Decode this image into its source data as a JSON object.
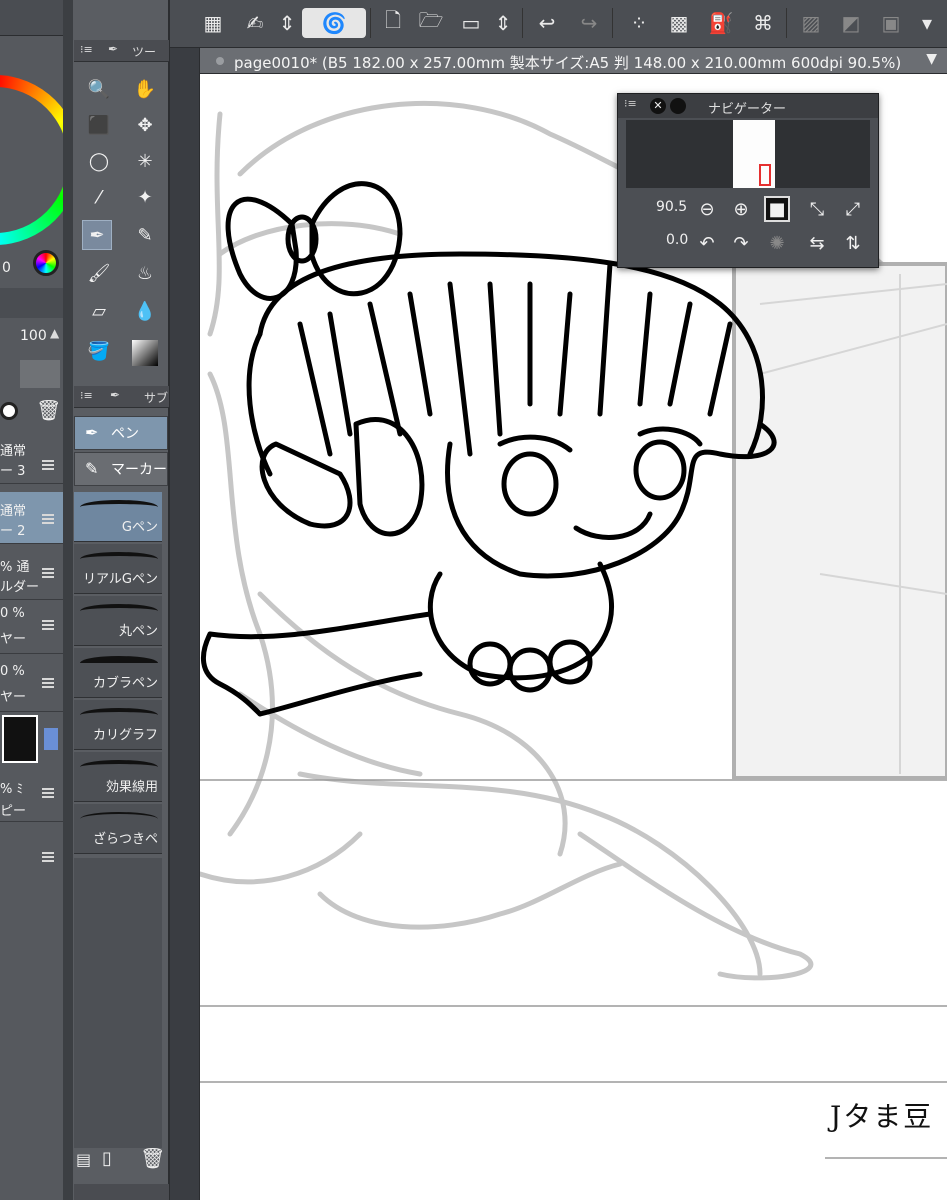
{
  "document": {
    "tab_title": "page0010* (B5 182.00 x 257.00mm 製本サイズ:A5 判 148.00 x 210.00mm 600dpi 90.5%)"
  },
  "left_panel": {
    "hue_value": "0",
    "opacity_value": "100",
    "layers": [
      {
        "line1": "通常",
        "line2": "ー 3"
      },
      {
        "line1": "通常",
        "line2": "ー 2"
      },
      {
        "line1": "% 通",
        "line2": "ルダー"
      },
      {
        "line1": "0 %",
        "line2": "ヤー"
      },
      {
        "line1": "0 %",
        "line2": "ヤー"
      },
      {
        "line1": "% ﾐ",
        "line2": "ピー"
      }
    ]
  },
  "tool_panel": {
    "tool_header": "ツー",
    "sub_header": "サブ",
    "subtools": [
      "ペン",
      "マーカー"
    ],
    "brushes": [
      "Gペン",
      "リアルGペン",
      "丸ペン",
      "カブラペン",
      "カリグラフ",
      "効果線用",
      "ざらつきペ"
    ]
  },
  "navigator": {
    "title": "ナビゲーター",
    "zoom_value": "90.5",
    "rotation_value": "0.0"
  },
  "canvas": {
    "ruby_text": "Jタま豆"
  },
  "icons": {
    "toolbar": [
      "grid-icon",
      "edit-icon",
      "spin-icon",
      "swirl-icon",
      "new-file-icon",
      "open-folder-icon",
      "canvas-icon",
      "undo-icon",
      "redo-icon",
      "scatter-icon",
      "transparent-icon",
      "fill-icon",
      "transform-icon",
      "pattern-icon",
      "checker-icon",
      "frame-icon"
    ]
  },
  "colors": {
    "accent_selected": "#7e96ad",
    "panel_bg": "#5a5d62"
  }
}
